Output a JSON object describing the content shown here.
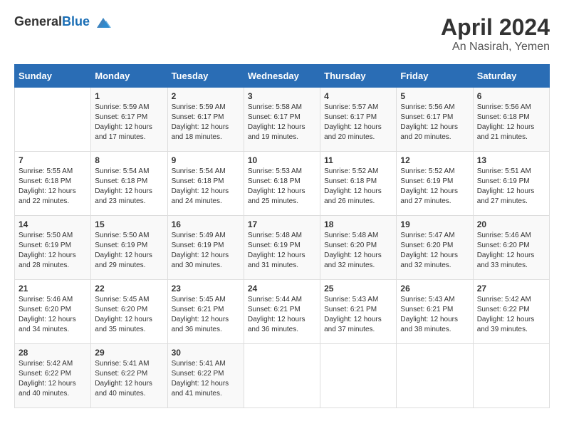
{
  "header": {
    "logo_general": "General",
    "logo_blue": "Blue",
    "month": "April 2024",
    "location": "An Nasirah, Yemen"
  },
  "calendar": {
    "days_of_week": [
      "Sunday",
      "Monday",
      "Tuesday",
      "Wednesday",
      "Thursday",
      "Friday",
      "Saturday"
    ],
    "weeks": [
      [
        {
          "day": "",
          "info": ""
        },
        {
          "day": "1",
          "info": "Sunrise: 5:59 AM\nSunset: 6:17 PM\nDaylight: 12 hours\nand 17 minutes."
        },
        {
          "day": "2",
          "info": "Sunrise: 5:59 AM\nSunset: 6:17 PM\nDaylight: 12 hours\nand 18 minutes."
        },
        {
          "day": "3",
          "info": "Sunrise: 5:58 AM\nSunset: 6:17 PM\nDaylight: 12 hours\nand 19 minutes."
        },
        {
          "day": "4",
          "info": "Sunrise: 5:57 AM\nSunset: 6:17 PM\nDaylight: 12 hours\nand 20 minutes."
        },
        {
          "day": "5",
          "info": "Sunrise: 5:56 AM\nSunset: 6:17 PM\nDaylight: 12 hours\nand 20 minutes."
        },
        {
          "day": "6",
          "info": "Sunrise: 5:56 AM\nSunset: 6:18 PM\nDaylight: 12 hours\nand 21 minutes."
        }
      ],
      [
        {
          "day": "7",
          "info": "Sunrise: 5:55 AM\nSunset: 6:18 PM\nDaylight: 12 hours\nand 22 minutes."
        },
        {
          "day": "8",
          "info": "Sunrise: 5:54 AM\nSunset: 6:18 PM\nDaylight: 12 hours\nand 23 minutes."
        },
        {
          "day": "9",
          "info": "Sunrise: 5:54 AM\nSunset: 6:18 PM\nDaylight: 12 hours\nand 24 minutes."
        },
        {
          "day": "10",
          "info": "Sunrise: 5:53 AM\nSunset: 6:18 PM\nDaylight: 12 hours\nand 25 minutes."
        },
        {
          "day": "11",
          "info": "Sunrise: 5:52 AM\nSunset: 6:18 PM\nDaylight: 12 hours\nand 26 minutes."
        },
        {
          "day": "12",
          "info": "Sunrise: 5:52 AM\nSunset: 6:19 PM\nDaylight: 12 hours\nand 27 minutes."
        },
        {
          "day": "13",
          "info": "Sunrise: 5:51 AM\nSunset: 6:19 PM\nDaylight: 12 hours\nand 27 minutes."
        }
      ],
      [
        {
          "day": "14",
          "info": "Sunrise: 5:50 AM\nSunset: 6:19 PM\nDaylight: 12 hours\nand 28 minutes."
        },
        {
          "day": "15",
          "info": "Sunrise: 5:50 AM\nSunset: 6:19 PM\nDaylight: 12 hours\nand 29 minutes."
        },
        {
          "day": "16",
          "info": "Sunrise: 5:49 AM\nSunset: 6:19 PM\nDaylight: 12 hours\nand 30 minutes."
        },
        {
          "day": "17",
          "info": "Sunrise: 5:48 AM\nSunset: 6:19 PM\nDaylight: 12 hours\nand 31 minutes."
        },
        {
          "day": "18",
          "info": "Sunrise: 5:48 AM\nSunset: 6:20 PM\nDaylight: 12 hours\nand 32 minutes."
        },
        {
          "day": "19",
          "info": "Sunrise: 5:47 AM\nSunset: 6:20 PM\nDaylight: 12 hours\nand 32 minutes."
        },
        {
          "day": "20",
          "info": "Sunrise: 5:46 AM\nSunset: 6:20 PM\nDaylight: 12 hours\nand 33 minutes."
        }
      ],
      [
        {
          "day": "21",
          "info": "Sunrise: 5:46 AM\nSunset: 6:20 PM\nDaylight: 12 hours\nand 34 minutes."
        },
        {
          "day": "22",
          "info": "Sunrise: 5:45 AM\nSunset: 6:20 PM\nDaylight: 12 hours\nand 35 minutes."
        },
        {
          "day": "23",
          "info": "Sunrise: 5:45 AM\nSunset: 6:21 PM\nDaylight: 12 hours\nand 36 minutes."
        },
        {
          "day": "24",
          "info": "Sunrise: 5:44 AM\nSunset: 6:21 PM\nDaylight: 12 hours\nand 36 minutes."
        },
        {
          "day": "25",
          "info": "Sunrise: 5:43 AM\nSunset: 6:21 PM\nDaylight: 12 hours\nand 37 minutes."
        },
        {
          "day": "26",
          "info": "Sunrise: 5:43 AM\nSunset: 6:21 PM\nDaylight: 12 hours\nand 38 minutes."
        },
        {
          "day": "27",
          "info": "Sunrise: 5:42 AM\nSunset: 6:22 PM\nDaylight: 12 hours\nand 39 minutes."
        }
      ],
      [
        {
          "day": "28",
          "info": "Sunrise: 5:42 AM\nSunset: 6:22 PM\nDaylight: 12 hours\nand 40 minutes."
        },
        {
          "day": "29",
          "info": "Sunrise: 5:41 AM\nSunset: 6:22 PM\nDaylight: 12 hours\nand 40 minutes."
        },
        {
          "day": "30",
          "info": "Sunrise: 5:41 AM\nSunset: 6:22 PM\nDaylight: 12 hours\nand 41 minutes."
        },
        {
          "day": "",
          "info": ""
        },
        {
          "day": "",
          "info": ""
        },
        {
          "day": "",
          "info": ""
        },
        {
          "day": "",
          "info": ""
        }
      ]
    ]
  }
}
